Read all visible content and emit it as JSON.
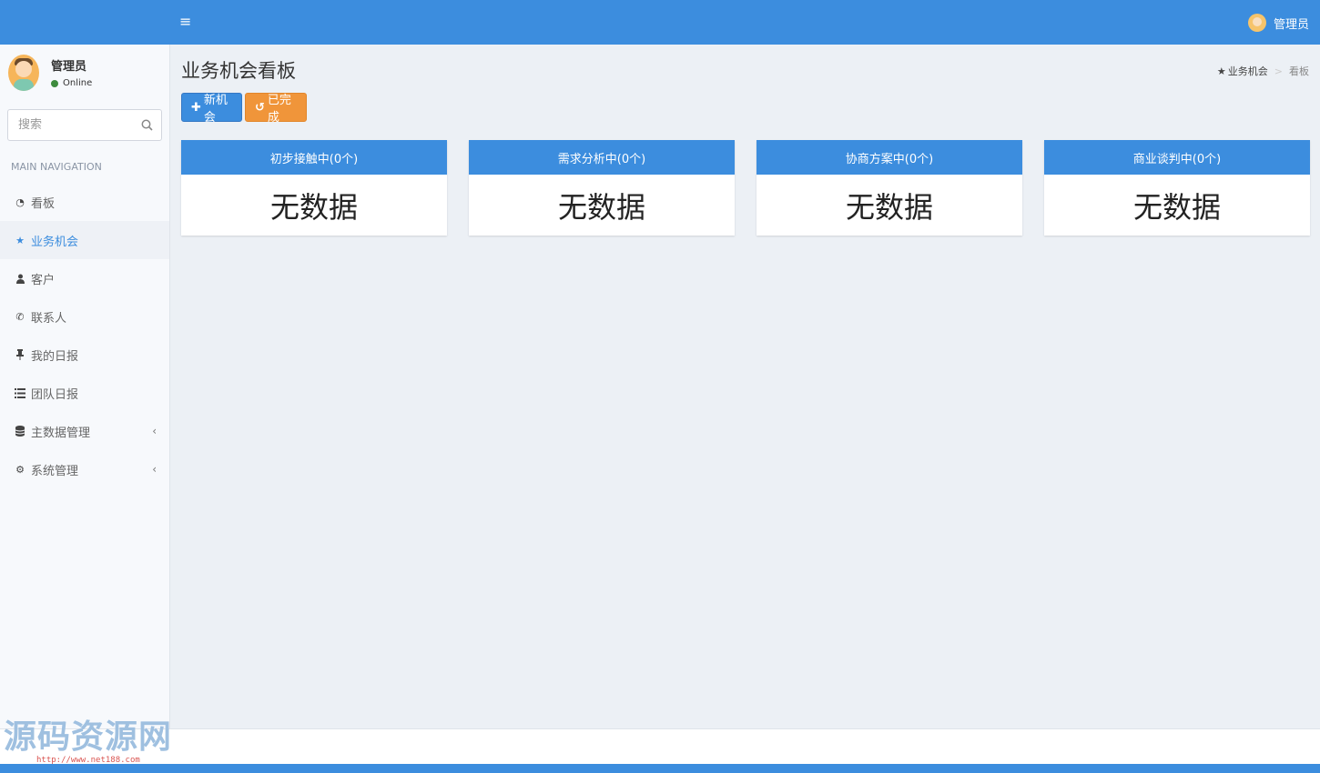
{
  "header": {
    "menu_icon": "hamburger-icon",
    "user_name": "管理员"
  },
  "sidebar": {
    "user": {
      "name": "管理员",
      "status": "Online",
      "status_color": "#3d8b3d"
    },
    "search": {
      "placeholder": "搜索",
      "icon": "search-icon"
    },
    "nav_header": "MAIN NAVIGATION",
    "items": [
      {
        "label": "看板",
        "icon": "dashboard-icon",
        "active": false
      },
      {
        "label": "业务机会",
        "icon": "star-icon",
        "active": true
      },
      {
        "label": "客户",
        "icon": "user-icon",
        "active": false
      },
      {
        "label": "联系人",
        "icon": "phone-icon",
        "active": false
      },
      {
        "label": "我的日报",
        "icon": "pin-icon",
        "active": false
      },
      {
        "label": "团队日报",
        "icon": "list-icon",
        "active": false
      },
      {
        "label": "主数据管理",
        "icon": "database-icon",
        "active": false,
        "has_submenu": true
      },
      {
        "label": "系统管理",
        "icon": "gears-icon",
        "active": false,
        "has_submenu": true
      }
    ]
  },
  "main": {
    "title": "业务机会看板",
    "breadcrumb": [
      {
        "label": "业务机会",
        "icon": "star-icon"
      },
      {
        "label": "看板"
      }
    ],
    "buttons": {
      "new": {
        "label": "新机会",
        "icon": "plus-icon"
      },
      "done": {
        "label": "已完成",
        "icon": "history-icon"
      }
    },
    "columns": [
      {
        "title": "初步接触中(0个)",
        "content": "无数据"
      },
      {
        "title": "需求分析中(0个)",
        "content": "无数据"
      },
      {
        "title": "协商方案中(0个)",
        "content": "无数据"
      },
      {
        "title": "商业谈判中(0个)",
        "content": "无数据"
      }
    ]
  },
  "watermark": {
    "text": "源码资源网",
    "url": "http://www.net188.com"
  },
  "colors": {
    "primary": "#3c8dde",
    "warning": "#f0953a",
    "background": "#ecf0f5"
  }
}
